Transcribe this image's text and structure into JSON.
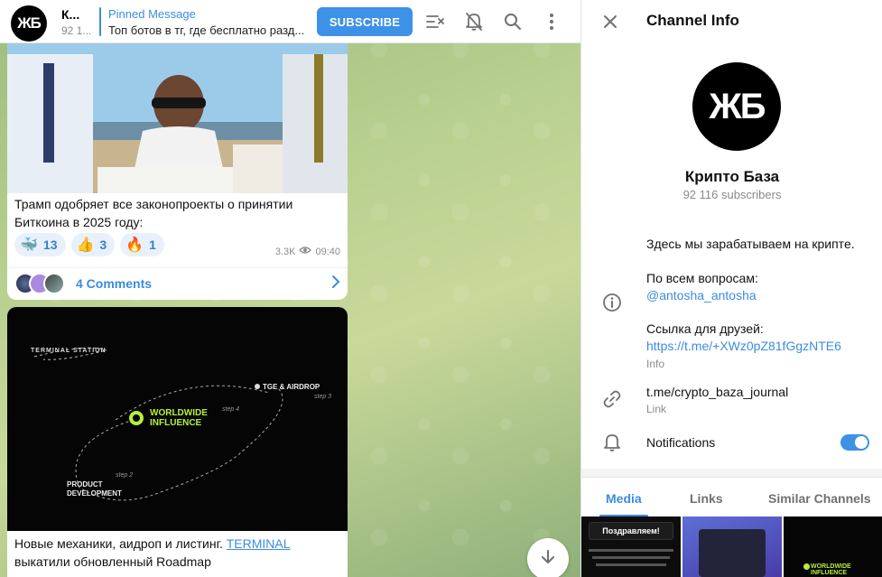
{
  "header": {
    "avatar_initials": "ЖБ",
    "channel_name": "К...",
    "subscribers_short": "92 1...",
    "pinned_title": "Pinned Message",
    "pinned_text": "Топ ботов в тг, где бесплатно разд...",
    "subscribe_label": "SUBSCRIBE"
  },
  "messages": [
    {
      "text": "Трамп одобряет все законопроекты о принятии Биткоина в 2025 году:",
      "reactions": [
        {
          "emoji": "🐳",
          "count": "13"
        },
        {
          "emoji": "👍",
          "count": "3"
        },
        {
          "emoji": "🔥",
          "count": "1"
        }
      ],
      "views": "3.3K",
      "time": "09:40",
      "comments_label": "4 Comments"
    },
    {
      "image": {
        "brand": "TERMINAL STATION",
        "center_label_1": "WORLDWIDE",
        "center_label_2": "INFLUENCE",
        "node_1": "TGE & AIRDROP",
        "node_2_line1": "PRODUCT",
        "node_2_line2": "DEVELOPMENT",
        "step_a": "step 4",
        "step_b": "step 2",
        "step_c": "step 3"
      },
      "text_prefix": "Новые механики, аидроп и листинг. ",
      "link_text": "TERMINAL",
      "text_suffix": "выкатили обновленный Roadmap"
    }
  ],
  "panel": {
    "title": "Channel Info",
    "avatar_initials": "ЖБ",
    "channel_title": "Крипто База",
    "subscribers": "92 116 subscribers",
    "about_1": "Здесь мы зарабатываем на крипте.",
    "about_2": "По всем вопросам:",
    "about_handle": "@antosha_antosha",
    "about_3": "Ссылка для друзей:",
    "about_invite": "https://t.me/+XWz0pZ81fGgzNTE6",
    "info_caption": "Info",
    "link_value": "t.me/crypto_baza_journal",
    "link_caption": "Link",
    "notifications_label": "Notifications",
    "notifications_on": true
  },
  "tabs": [
    {
      "label": "Media",
      "active": true
    },
    {
      "label": "Links",
      "active": false
    },
    {
      "label": "Similar Channels",
      "active": false
    }
  ],
  "media_thumbs": {
    "thumb_1_title": "Поздравляем!",
    "thumb_3_label": "WORLDWIDE INFLUENCE"
  },
  "colors": {
    "accent": "#3a8de0",
    "button": "#3d91e6",
    "chat_bg": "#b7cf8f"
  }
}
